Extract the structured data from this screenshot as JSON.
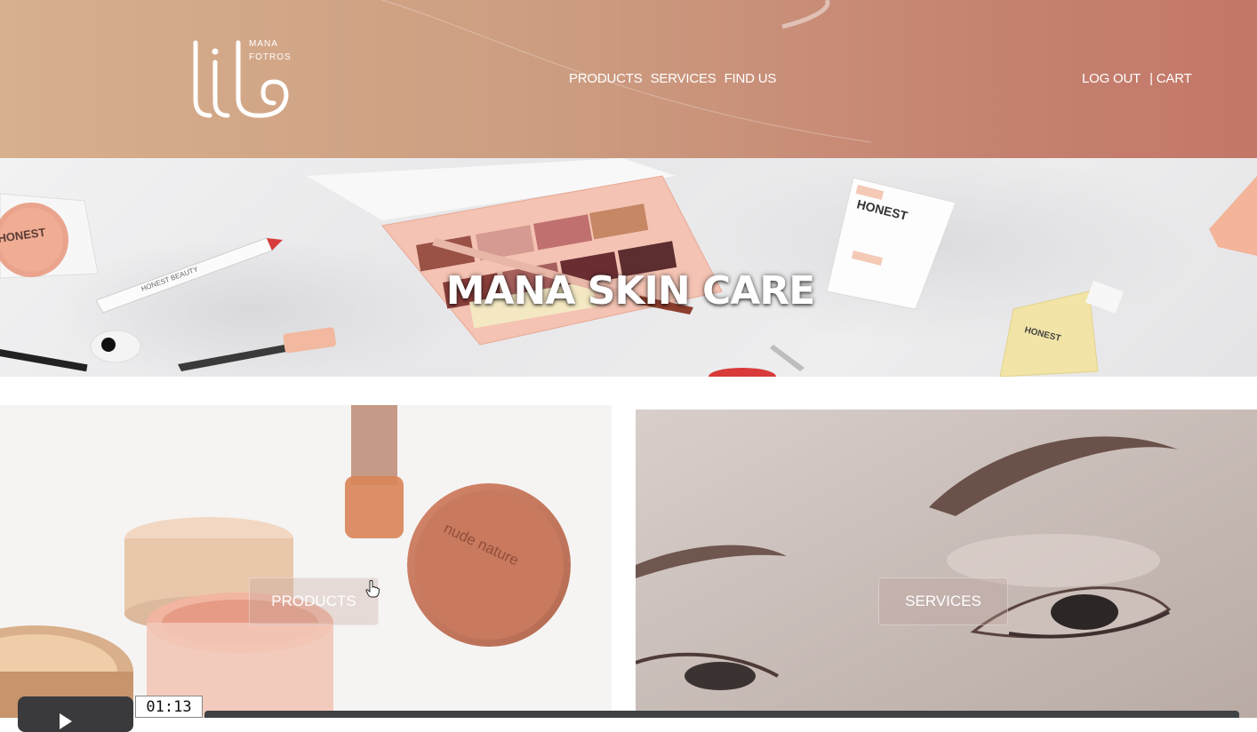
{
  "header": {
    "logo_text_line1": "MANA",
    "logo_text_line2": "FOTROS",
    "nav": [
      "PRODUCTS",
      "SERVICES",
      "FIND US"
    ],
    "account": {
      "logout": "LOG OUT",
      "cart": "| CART"
    },
    "gradient_start": "#d7b08e",
    "gradient_end": "#c37868"
  },
  "hero": {
    "title": "MANA SKIN CARE",
    "brand_labels": {
      "tube": "HONEST",
      "left_compact": "HONEST",
      "pencil": "HONEST BEAUTY",
      "serum": "HONEST"
    }
  },
  "tiles": {
    "products_button": "PRODUCTS",
    "services_button": "SERVICES",
    "jar_label": "nude nature"
  },
  "player": {
    "time": "01:13",
    "play_icon": "play-icon"
  },
  "cursor": {
    "icon": "hand-pointer-icon"
  }
}
